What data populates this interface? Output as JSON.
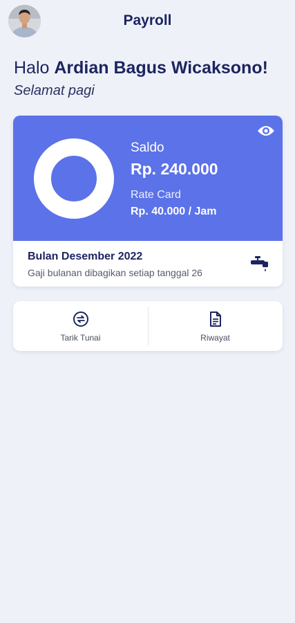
{
  "header": {
    "title": "Payroll"
  },
  "greeting": {
    "prefix": "Halo",
    "name": "Ardian Bagus Wicaksono!",
    "subtitle": "Selamat pagi"
  },
  "balance_card": {
    "saldo_label": "Saldo",
    "saldo_value": "Rp. 240.000",
    "rate_label": "Rate Card",
    "rate_value": "Rp. 40.000 / Jam",
    "month_title": "Bulan Desember 2022",
    "month_note": "Gaji bulanan dibagikan setiap tanggal 26",
    "icons": [
      "eye-icon",
      "tap-icon"
    ]
  },
  "actions": [
    {
      "label": "Tarik Tunai",
      "icon": "transfer-icon"
    },
    {
      "label": "Riwayat",
      "icon": "document-icon"
    }
  ],
  "colors": {
    "background": "#eef2f8",
    "accent": "#5c72e8",
    "text_primary": "#1d2460"
  }
}
